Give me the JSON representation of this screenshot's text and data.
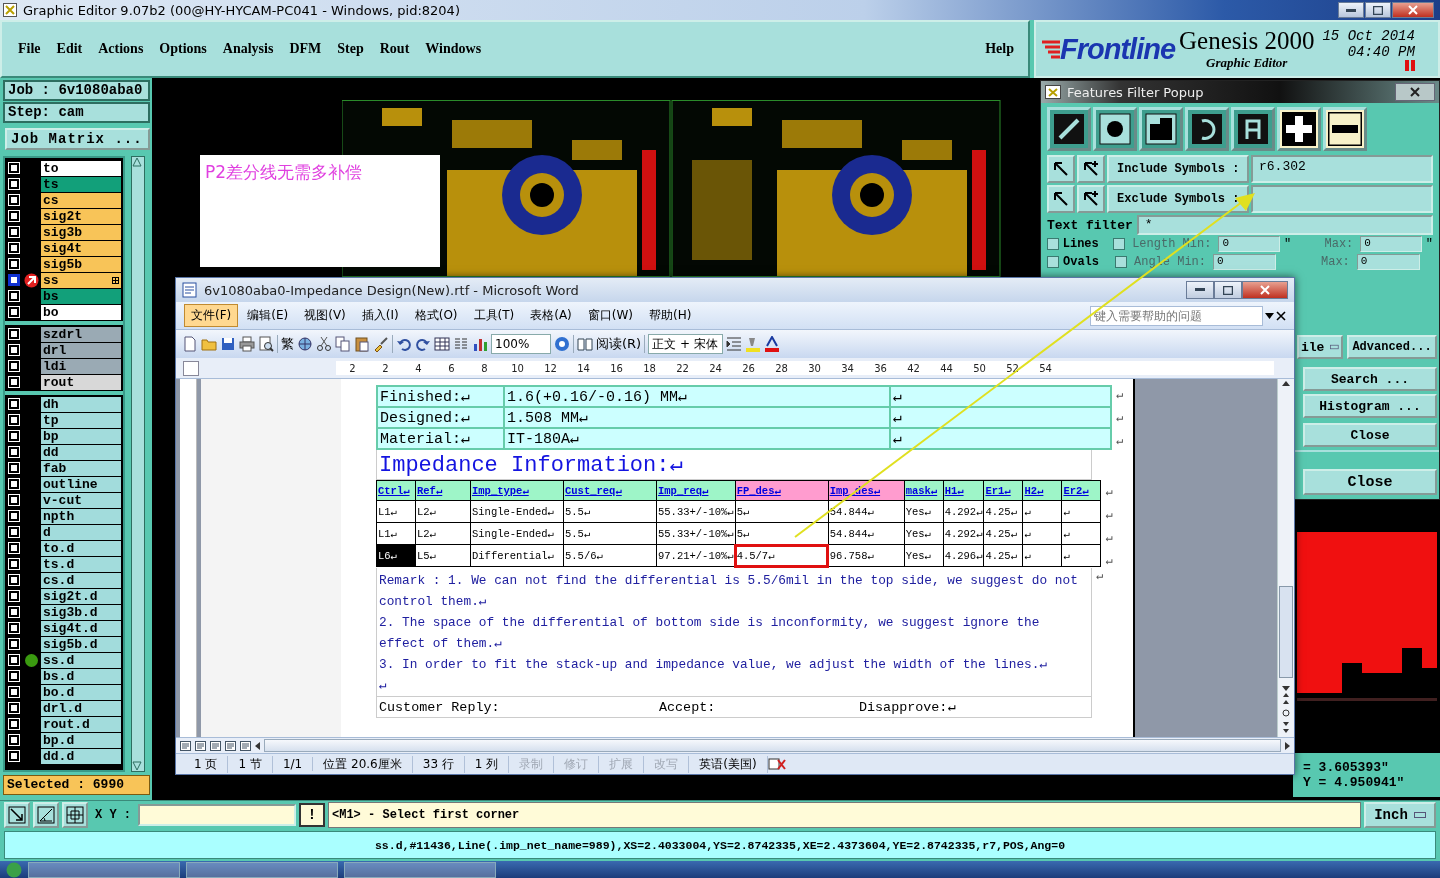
{
  "title_bar": {
    "title": "Graphic Editor 9.07b2 (00@HY-HYCAM-PC041 - Windows, pid:8204)"
  },
  "menu": [
    "File",
    "Edit",
    "Actions",
    "Options",
    "Analysis",
    "DFM",
    "Step",
    "Rout",
    "Windows"
  ],
  "help_menu": "Help",
  "brand": {
    "logo": "Frontline",
    "product": "Genesis 2000",
    "subtitle": "Graphic Editor",
    "date": "15 Oct 2014",
    "time": "04:40 PM"
  },
  "job": {
    "job": "Job : 6v1080aba0",
    "step": "Step: cam",
    "matrix_button": "Job Matrix ..."
  },
  "layer_groups": [
    {
      "layers": [
        {
          "name": "to",
          "color": "#ffffff",
          "checked": false,
          "work": false,
          "marked": false
        },
        {
          "name": "ts",
          "color": "#12a07a",
          "checked": false,
          "work": false,
          "marked": false
        },
        {
          "name": "cs",
          "color": "#f8c458",
          "checked": false,
          "work": false,
          "marked": false
        },
        {
          "name": "sig2t",
          "color": "#f8c458",
          "checked": false,
          "work": false,
          "marked": false
        },
        {
          "name": "sig3b",
          "color": "#f8c458",
          "checked": false,
          "work": false,
          "marked": false
        },
        {
          "name": "sig4t",
          "color": "#f8c458",
          "checked": false,
          "work": false,
          "marked": false
        },
        {
          "name": "sig5b",
          "color": "#f8c458",
          "checked": false,
          "work": false,
          "marked": false
        },
        {
          "name": "ss",
          "color": "#f8c458",
          "checked": false,
          "work": true,
          "marked": false
        },
        {
          "name": "bs",
          "color": "#12a07a",
          "checked": false,
          "work": false,
          "marked": false
        },
        {
          "name": "bo",
          "color": "#ffffff",
          "checked": false,
          "work": false,
          "marked": false
        }
      ]
    },
    {
      "layers": [
        {
          "name": "szdrl",
          "color": "#9aaab4",
          "checked": false,
          "work": false,
          "marked": false
        },
        {
          "name": "drl",
          "color": "#9aaab4",
          "checked": false,
          "work": false,
          "marked": false
        },
        {
          "name": "ldi",
          "color": "#9aaab4",
          "checked": false,
          "work": false,
          "marked": false
        },
        {
          "name": "rout",
          "color": "#d8d8d8",
          "checked": false,
          "work": false,
          "marked": false
        }
      ]
    },
    {
      "layers": [
        {
          "name": "dh",
          "color": "#a2dcdc",
          "checked": false,
          "work": false,
          "marked": false
        },
        {
          "name": "tp",
          "color": "#a2dcdc",
          "checked": false,
          "work": false,
          "marked": false
        },
        {
          "name": "bp",
          "color": "#a2dcdc",
          "checked": false,
          "work": false,
          "marked": false
        },
        {
          "name": "dd",
          "color": "#a2dcdc",
          "checked": false,
          "work": false,
          "marked": false
        },
        {
          "name": "fab",
          "color": "#a2dcdc",
          "checked": false,
          "work": false,
          "marked": false
        },
        {
          "name": "outline",
          "color": "#a2dcdc",
          "checked": false,
          "work": false,
          "marked": false
        },
        {
          "name": "v-cut",
          "color": "#a2dcdc",
          "checked": false,
          "work": false,
          "marked": false
        },
        {
          "name": "npth",
          "color": "#a2dcdc",
          "checked": false,
          "work": false,
          "marked": false
        },
        {
          "name": "d",
          "color": "#a2dcdc",
          "checked": false,
          "work": false,
          "marked": false
        },
        {
          "name": "to.d",
          "color": "#a2dcdc",
          "checked": false,
          "work": false,
          "marked": false
        },
        {
          "name": "ts.d",
          "color": "#a2dcdc",
          "checked": false,
          "work": false,
          "marked": false
        },
        {
          "name": "cs.d",
          "color": "#a2dcdc",
          "checked": false,
          "work": false,
          "marked": false
        },
        {
          "name": "sig2t.d",
          "color": "#a2dcdc",
          "checked": false,
          "work": false,
          "marked": false
        },
        {
          "name": "sig3b.d",
          "color": "#a2dcdc",
          "checked": false,
          "work": false,
          "marked": false
        },
        {
          "name": "sig4t.d",
          "color": "#a2dcdc",
          "checked": false,
          "work": false,
          "marked": false
        },
        {
          "name": "sig5b.d",
          "color": "#a2dcdc",
          "checked": false,
          "work": false,
          "marked": false
        },
        {
          "name": "ss.d",
          "color": "#a2dcdc",
          "checked": false,
          "work": false,
          "marked": true
        },
        {
          "name": "bs.d",
          "color": "#a2dcdc",
          "checked": false,
          "work": false,
          "marked": false
        },
        {
          "name": "bo.d",
          "color": "#a2dcdc",
          "checked": false,
          "work": false,
          "marked": false
        },
        {
          "name": "drl.d",
          "color": "#a2dcdc",
          "checked": false,
          "work": false,
          "marked": false
        },
        {
          "name": "rout.d",
          "color": "#a2dcdc",
          "checked": false,
          "work": false,
          "marked": false
        },
        {
          "name": "bp.d",
          "color": "#a2dcdc",
          "checked": false,
          "work": false,
          "marked": false
        },
        {
          "name": "dd.d",
          "color": "#a2dcdc",
          "checked": false,
          "work": false,
          "marked": false
        }
      ]
    }
  ],
  "selected_count": "Selected : 6990",
  "canvas": {
    "note": "P2差分线无需多补偿"
  },
  "filter_popup": {
    "title": "Features Filter Popup",
    "feature_tools": [
      {
        "kind": "line"
      },
      {
        "kind": "pad"
      },
      {
        "kind": "surface"
      },
      {
        "kind": "arc"
      },
      {
        "kind": "text"
      }
    ],
    "polarity": [
      {
        "kind": "positive",
        "selected": true
      },
      {
        "kind": "negative",
        "selected": false
      }
    ],
    "include_label": "Include Symbols :",
    "include_value": "r6.302",
    "exclude_label": "Exclude Symbols :",
    "text_filter_label": "Text filter",
    "text_filter_value": "*",
    "attr_rows": [
      {
        "label": "Lines",
        "checked": false,
        "param_checked": false,
        "param": "Length",
        "min_label": "Min:",
        "min": "0",
        "min_unit": "\"",
        "max_label": "Max:",
        "max": "0",
        "max_unit": "\""
      },
      {
        "label": "Ovals",
        "checked": false,
        "param_checked": false,
        "param": "Angle",
        "min_label": "Min:",
        "min": "0",
        "max_label": "Max:",
        "max": "0"
      }
    ],
    "profile_button": "ile",
    "advanced_button": "Advanced...",
    "search_button": "Search ...",
    "histogram_button": "Histogram ...",
    "close_buttons": [
      "Close",
      "Close"
    ]
  },
  "coords": {
    "x": "= 3.605393\"",
    "y": "Y = 4.950941\""
  },
  "word": {
    "title": "6v1080aba0-Impedance Design(New).rtf - Microsoft Word",
    "menu": [
      {
        "label": "文件(F)",
        "selected": true
      },
      {
        "label": "编辑(E)",
        "selected": false
      },
      {
        "label": "视图(V)",
        "selected": false
      },
      {
        "label": "插入(I)",
        "selected": false
      },
      {
        "label": "格式(O)",
        "selected": false
      },
      {
        "label": "工具(T)",
        "selected": false
      },
      {
        "label": "表格(A)",
        "selected": false
      },
      {
        "label": "窗口(W)",
        "selected": false
      },
      {
        "label": "帮助(H)",
        "selected": false
      }
    ],
    "help_placeholder": "键入需要帮助的问题",
    "toolbar": {
      "trad": "繁",
      "zoom": "100%",
      "read": "阅读(R)",
      "style": "正文 + 宋体"
    },
    "ruler": [
      "2",
      "2",
      "4",
      "6",
      "8",
      "10",
      "12",
      "14",
      "16",
      "18",
      "22",
      "24",
      "26",
      "28",
      "30",
      "34",
      "36",
      "42",
      "44",
      "50",
      "52",
      "54"
    ],
    "info_rows": [
      [
        "Finished:↵",
        "1.6(+0.16/-0.16) MM↵",
        "↵",
        "↵"
      ],
      [
        "Designed:↵",
        "1.508 MM↵",
        "↵",
        "↵"
      ],
      [
        "Material:↵",
        "IT-180A↵",
        "↵",
        "↵"
      ]
    ],
    "heading": "Impedance Information:↵",
    "columns": [
      {
        "label": "Ctrl↵",
        "color": "#9ef5c8"
      },
      {
        "label": "Ref↵",
        "color": "#9ef5c8"
      },
      {
        "label": "Imp_type↵",
        "color": "#9ef5c8"
      },
      {
        "label": "Cust_req↵",
        "color": "#9ef5c8"
      },
      {
        "label": "Imp_req↵",
        "color": "#9ef5c8"
      },
      {
        "label": "FP_des↵",
        "color": "#ff9ccf"
      },
      {
        "label": "Imp_des↵",
        "color": "#ff9ccf"
      },
      {
        "label": "mask↵",
        "color": "#9ef5c8"
      },
      {
        "label": "H1↵",
        "color": "#9ef5c8"
      },
      {
        "label": "Er1↵",
        "color": "#9ef5c8"
      },
      {
        "label": "H2↵",
        "color": "#9ef5c8"
      },
      {
        "label": "Er2↵",
        "color": "#9ef5c8"
      }
    ],
    "header_end": "↵",
    "rows": [
      {
        "cells": [
          "L1↵",
          "L2↵",
          "Single-Ended↵",
          "5.5↵",
          "55.33+/-10%↵",
          "5↵",
          "54.844↵",
          "Yes↵",
          "4.292↵",
          "4.25↵",
          "↵",
          "↵"
        ],
        "end": "↵",
        "ctrl_selected": false,
        "fp_boxed": false
      },
      {
        "cells": [
          "L1↵",
          "L2↵",
          "Single-Ended↵",
          "5.5↵",
          "55.33+/-10%↵",
          "5↵",
          "54.844↵",
          "Yes↵",
          "4.292↵",
          "4.25↵",
          "↵",
          "↵"
        ],
        "end": "↵",
        "ctrl_selected": false,
        "fp_boxed": false
      },
      {
        "cells": [
          "L6↵",
          "L5↵",
          "Differential↵",
          "5.5/6↵",
          "97.21+/-10%↵",
          "4.5/7↵",
          "96.758↵",
          "Yes↵",
          "4.296↵",
          "4.25↵",
          "↵",
          "↵"
        ],
        "end": "↵",
        "ctrl_selected": true,
        "fp_boxed": true
      }
    ],
    "remarks": [
      "Remark : 1. We can not find the differential is 5.5/6mil in the top side, we suggest do not control them.↵",
      "2. The space of the differential of bottom side is inconformity, we suggest ignore the effect of them.↵",
      "3. In order to fit the stack-up and impedance value, we adjust the width of the lines.↵",
      "↵"
    ],
    "remarks_end": "↵",
    "reply": [
      "Customer Reply:",
      "Accept:",
      "Disapprove:↵"
    ],
    "status": [
      {
        "text": "1 页",
        "disabled": false
      },
      {
        "text": "1 节",
        "disabled": false
      },
      {
        "text": "1/1",
        "disabled": false
      },
      {
        "text": "位置 20.6厘米",
        "disabled": false
      },
      {
        "text": "33 行",
        "disabled": false
      },
      {
        "text": "1 列",
        "disabled": false
      },
      {
        "text": "录制",
        "disabled": true
      },
      {
        "text": "修订",
        "disabled": true
      },
      {
        "text": "扩展",
        "disabled": true
      },
      {
        "text": "改写",
        "disabled": true
      },
      {
        "text": "英语(美国)",
        "disabled": false
      }
    ]
  },
  "command_bar": {
    "xy_label": "X Y :",
    "warn": "!",
    "prompt": "<M1> - Select first corner",
    "units": "Inch"
  },
  "status_line": "ss.d,#11436,Line(.imp_net_name=989),XS=2.4033004,YS=2.8742335,XE=2.4373604,YE=2.8742335,r7,POS,Ang=0"
}
